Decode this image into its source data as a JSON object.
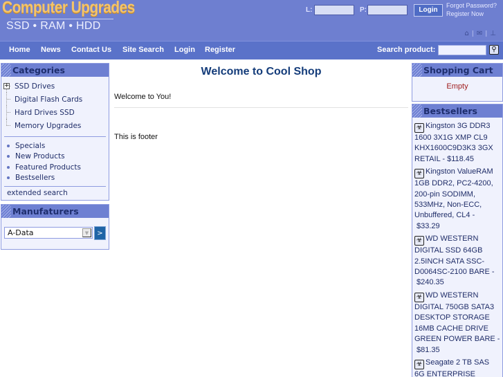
{
  "header": {
    "logo_title": "Computer Upgrades",
    "logo_subtitle": "SSD • RAM • HDD",
    "login_label": "L:",
    "password_label": "P:",
    "login_value": "",
    "password_value": "",
    "login_button": "Login",
    "forgot_password": "Forgot Password?",
    "register_now": "Register Now",
    "icons": [
      "home-icon",
      "mail-icon",
      "sitemap-icon"
    ]
  },
  "nav": {
    "items": [
      "Home",
      "News",
      "Contact Us",
      "Site Search",
      "Login",
      "Register"
    ],
    "search_label": "Search product:",
    "search_value": "",
    "search_button_icon": "magnifier-icon"
  },
  "categories": {
    "title": "Categories",
    "items": [
      "SSD Drives",
      "Digital Flash Cards",
      "Hard Drives SSD",
      "Memory Upgrades"
    ],
    "links": [
      "Specials",
      "New Products",
      "Featured Products",
      "Bestsellers"
    ],
    "extended_search": "extended search"
  },
  "manufacturers": {
    "title": "Manufaturers",
    "selected": "A-Data",
    "go_button": ">"
  },
  "main": {
    "title": "Welcome to Cool Shop",
    "welcome": "Welcome to You!",
    "footer": "This is footer"
  },
  "cart": {
    "title": "Shopping Cart",
    "status": "Empty"
  },
  "bestsellers": {
    "title": "Bestsellers",
    "items": [
      {
        "name": "Kingston 3G DDR3 1600 3X1G XMP CL9 KHX1600C9D3K3 3GX RETAIL -",
        "price": "$118.45"
      },
      {
        "name": "Kingston ValueRAM 1GB DDR2, PC2-4200, 200-pin SODIMM, 533MHz, Non-ECC, Unbuffered, CL4 -",
        "price": "$33.29"
      },
      {
        "name": "WD WESTERN DIGITAL SSD 64GB 2.5INCH SATA SSC-D0064SC-2100 BARE -",
        "price": "$240.35"
      },
      {
        "name": "WD WESTERN DIGITAL 750GB SATA3 DESKTOP STORAGE 16MB CACHE DRIVE GREEN POWER BARE -",
        "price": "$81.35"
      },
      {
        "name": "Seagate 2 TB SAS 6G ENTERPRISE",
        "price": ""
      }
    ]
  }
}
